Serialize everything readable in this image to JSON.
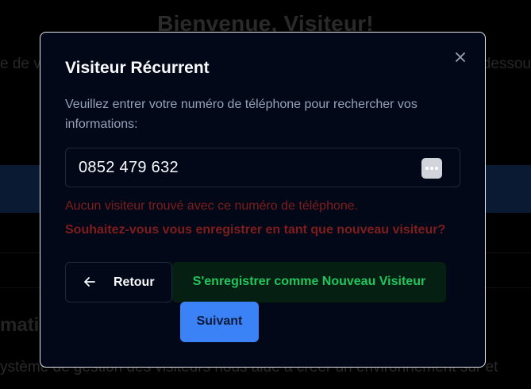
{
  "background": {
    "title": "Bienvenue, Visiteur!",
    "left_fragment": "e de v",
    "right_fragment": "dessou",
    "heading_fragment": "matio",
    "bottom_fragment": "ystème de gestion des visiteurs nous aide à créer un environnement sûr et"
  },
  "modal": {
    "title": "Visiteur Récurrent",
    "description": "Veuillez entrer votre numéro de téléphone pour rechercher vos informations:",
    "phone_value": "0852 479 632",
    "error_not_found": "Aucun visiteur trouvé avec ce numéro de téléphone.",
    "error_prompt": "Souhaitez-vous vous enregistrer en tant que nouveau visiteur?",
    "back_label": "Retour",
    "register_label": "S'enregistrer comme Nouveau Visiteur",
    "next_label": "Suivant"
  },
  "colors": {
    "accent": "#3b82f6",
    "success": "#22c55e",
    "error": "#7f1d1d",
    "modal_bg": "#020817"
  }
}
